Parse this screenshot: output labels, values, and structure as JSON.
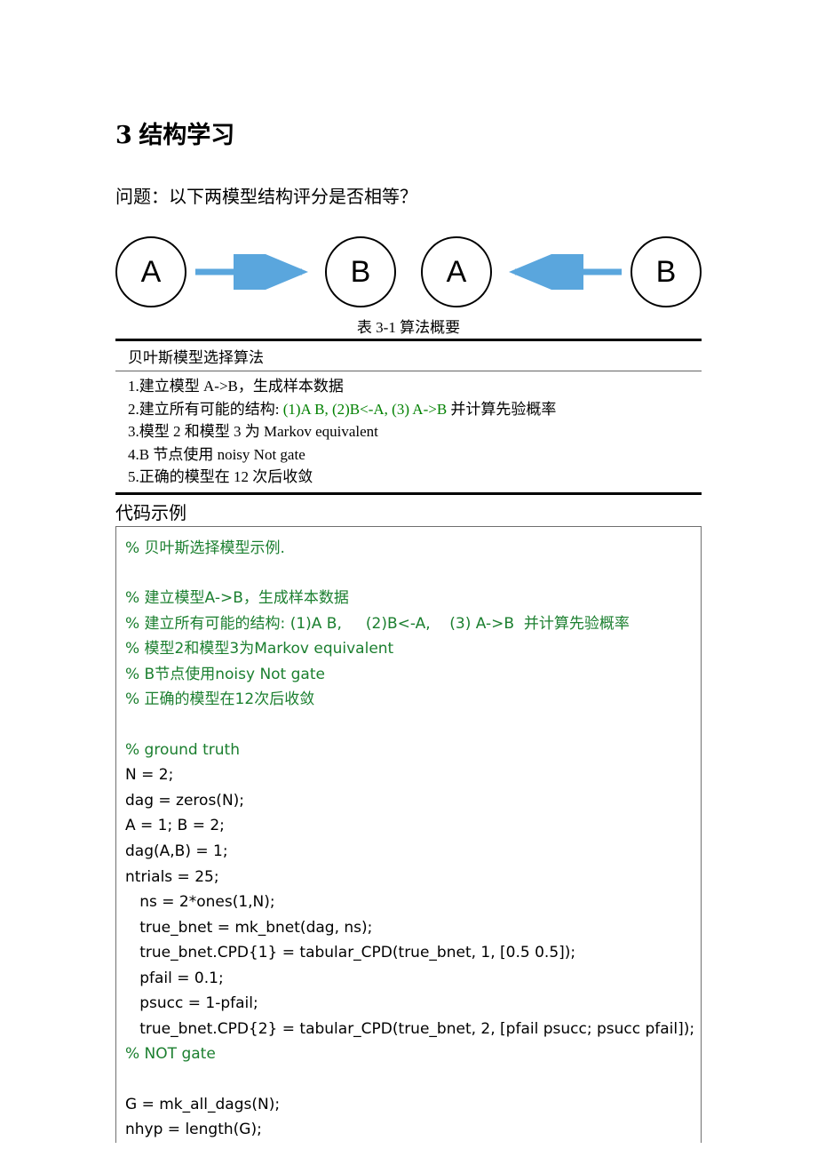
{
  "heading": {
    "num": "3",
    "title": "结构学习"
  },
  "question": "问题：以下两模型结构评分是否相等？",
  "diagram": {
    "nodes": [
      "A",
      "B",
      "A",
      "B"
    ]
  },
  "table_caption": "表 3-1  算法概要",
  "algo_header": "贝叶斯模型选择算法",
  "algo_lines": [
    {
      "segments": [
        {
          "text": "1.建立模型 A->B，生成样本数据",
          "cls": ""
        }
      ]
    },
    {
      "segments": [
        {
          "text": "2.建立所有可能的结构: ",
          "cls": ""
        },
        {
          "text": "(1)A B,     (2)B<-A,    (3) A->B",
          "cls": "green ascii"
        },
        {
          "text": "  并计算先验概率",
          "cls": ""
        }
      ]
    },
    {
      "segments": [
        {
          "text": "3.模型 2 和模型 3 为 Markov equivalent",
          "cls": ""
        }
      ]
    },
    {
      "segments": [
        {
          "text": "4.B 节点使用 noisy Not gate",
          "cls": ""
        }
      ]
    },
    {
      "segments": [
        {
          "text": "5.正确的模型在 12 次后收敛",
          "cls": ""
        }
      ]
    }
  ],
  "code_title": "代码示例",
  "code": [
    {
      "cls": "cmt",
      "text": "% 贝叶斯选择模型示例."
    },
    {
      "cls": "blank",
      "text": ""
    },
    {
      "cls": "cmt",
      "text": "% 建立模型A->B，生成样本数据"
    },
    {
      "cls": "cmt",
      "text": "% 建立所有可能的结构: (1)A B,     (2)B<-A,    (3) A->B  并计算先验概率"
    },
    {
      "cls": "cmt",
      "text": "% 模型2和模型3为Markov equivalent"
    },
    {
      "cls": "cmt",
      "text": "% B节点使用noisy Not gate"
    },
    {
      "cls": "cmt",
      "text": "% 正确的模型在12次后收敛"
    },
    {
      "cls": "blank",
      "text": ""
    },
    {
      "cls": "cmt",
      "text": "% ground truth"
    },
    {
      "cls": "",
      "text": "N = 2;"
    },
    {
      "cls": "",
      "text": "dag = zeros(N);"
    },
    {
      "cls": "",
      "text": "A = 1; B = 2;"
    },
    {
      "cls": "",
      "text": "dag(A,B) = 1;"
    },
    {
      "cls": "",
      "text": "ntrials = 25;"
    },
    {
      "cls": "",
      "text": "   ns = 2*ones(1,N);"
    },
    {
      "cls": "",
      "text": "   true_bnet = mk_bnet(dag, ns);"
    },
    {
      "cls": "",
      "text": "   true_bnet.CPD{1} = tabular_CPD(true_bnet, 1, [0.5 0.5]);"
    },
    {
      "cls": "",
      "text": "   pfail = 0.1;"
    },
    {
      "cls": "",
      "text": "   psucc = 1-pfail;"
    },
    {
      "cls": "",
      "text": "   true_bnet.CPD{2} = tabular_CPD(true_bnet, 2, [pfail psucc; psucc pfail]);"
    },
    {
      "cls": "cmt",
      "text": "% NOT gate"
    },
    {
      "cls": "blank",
      "text": ""
    },
    {
      "cls": "",
      "text": "G = mk_all_dags(N);"
    },
    {
      "cls": "",
      "text": "nhyp = length(G);"
    }
  ]
}
